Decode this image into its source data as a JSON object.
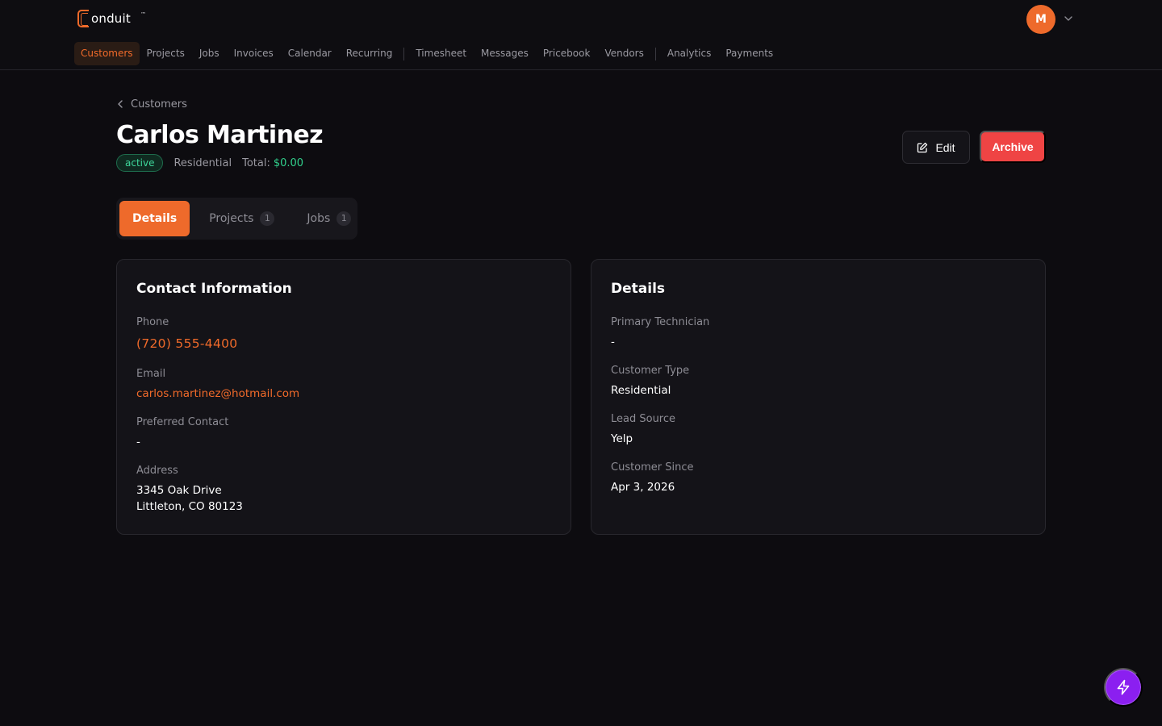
{
  "app": {
    "logo_text": "onduit",
    "logo_tm": "™",
    "avatar_initial": "M"
  },
  "nav": {
    "items": [
      {
        "label": "Customers",
        "active": true
      },
      {
        "label": "Projects"
      },
      {
        "label": "Jobs"
      },
      {
        "label": "Invoices"
      },
      {
        "label": "Calendar"
      },
      {
        "label": "Recurring"
      },
      {
        "label": "Timesheet"
      },
      {
        "label": "Messages"
      },
      {
        "label": "Pricebook"
      },
      {
        "label": "Vendors"
      },
      {
        "label": "Analytics"
      },
      {
        "label": "Payments"
      }
    ]
  },
  "breadcrumb": {
    "label": "Customers"
  },
  "customer": {
    "name": "Carlos Martinez",
    "status": "active",
    "type": "Residential",
    "total_label": "Total:",
    "total_value": "$0.00"
  },
  "actions": {
    "edit_label": "Edit",
    "archive_label": "Archive"
  },
  "tabs": {
    "details": {
      "label": "Details"
    },
    "projects": {
      "label": "Projects",
      "count": "1"
    },
    "jobs": {
      "label": "Jobs",
      "count": "1"
    }
  },
  "contact": {
    "title": "Contact Information",
    "phone_label": "Phone",
    "phone_value": "(720) 555-4400",
    "email_label": "Email",
    "email_value": "carlos.martinez@hotmail.com",
    "preferred_label": "Preferred Contact",
    "preferred_value": "-",
    "address_label": "Address",
    "address_line1": "3345 Oak Drive",
    "address_line2": "Littleton, CO 80123"
  },
  "details": {
    "title": "Details",
    "technician_label": "Primary Technician",
    "technician_value": "-",
    "type_label": "Customer Type",
    "type_value": "Residential",
    "lead_label": "Lead Source",
    "lead_value": "Yelp",
    "since_label": "Customer Since",
    "since_value": "Apr 3, 2026"
  },
  "colors": {
    "accent": "#ee6a2b",
    "danger": "#ef4444",
    "success": "#31d08c",
    "fab": "#8b1ff0",
    "background": "#0d0c10"
  },
  "icons": {
    "breadcrumb": "chevron-left-icon",
    "avatar_menu": "chevron-down-icon",
    "edit": "edit-icon",
    "fab": "lightning-icon"
  }
}
